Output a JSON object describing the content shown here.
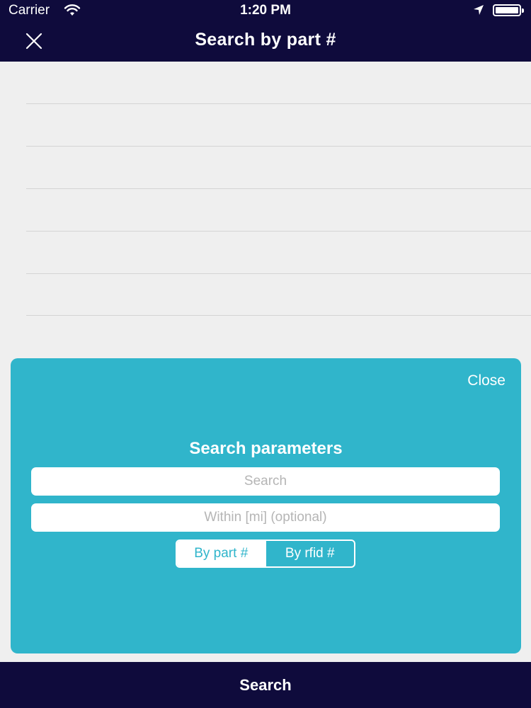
{
  "status_bar": {
    "carrier": "Carrier",
    "time": "1:20 PM",
    "icons": [
      "wifi-icon",
      "location-arrow-icon",
      "battery-icon"
    ]
  },
  "nav": {
    "title": "Search by part #",
    "close_icon": "close-icon"
  },
  "list": {
    "row_count": 6
  },
  "panel": {
    "close_label": "Close",
    "title": "Search parameters",
    "search_placeholder": "Search",
    "search_value": "",
    "within_placeholder": "Within [mi] (optional)",
    "within_value": "",
    "segments": [
      {
        "label": "By part #",
        "selected": true
      },
      {
        "label": "By rfid #",
        "selected": false
      }
    ]
  },
  "bottom_button": {
    "label": "Search"
  },
  "colors": {
    "navy": "#0f0b3c",
    "panel_teal": "#30b5cb",
    "background": "#efefef"
  }
}
